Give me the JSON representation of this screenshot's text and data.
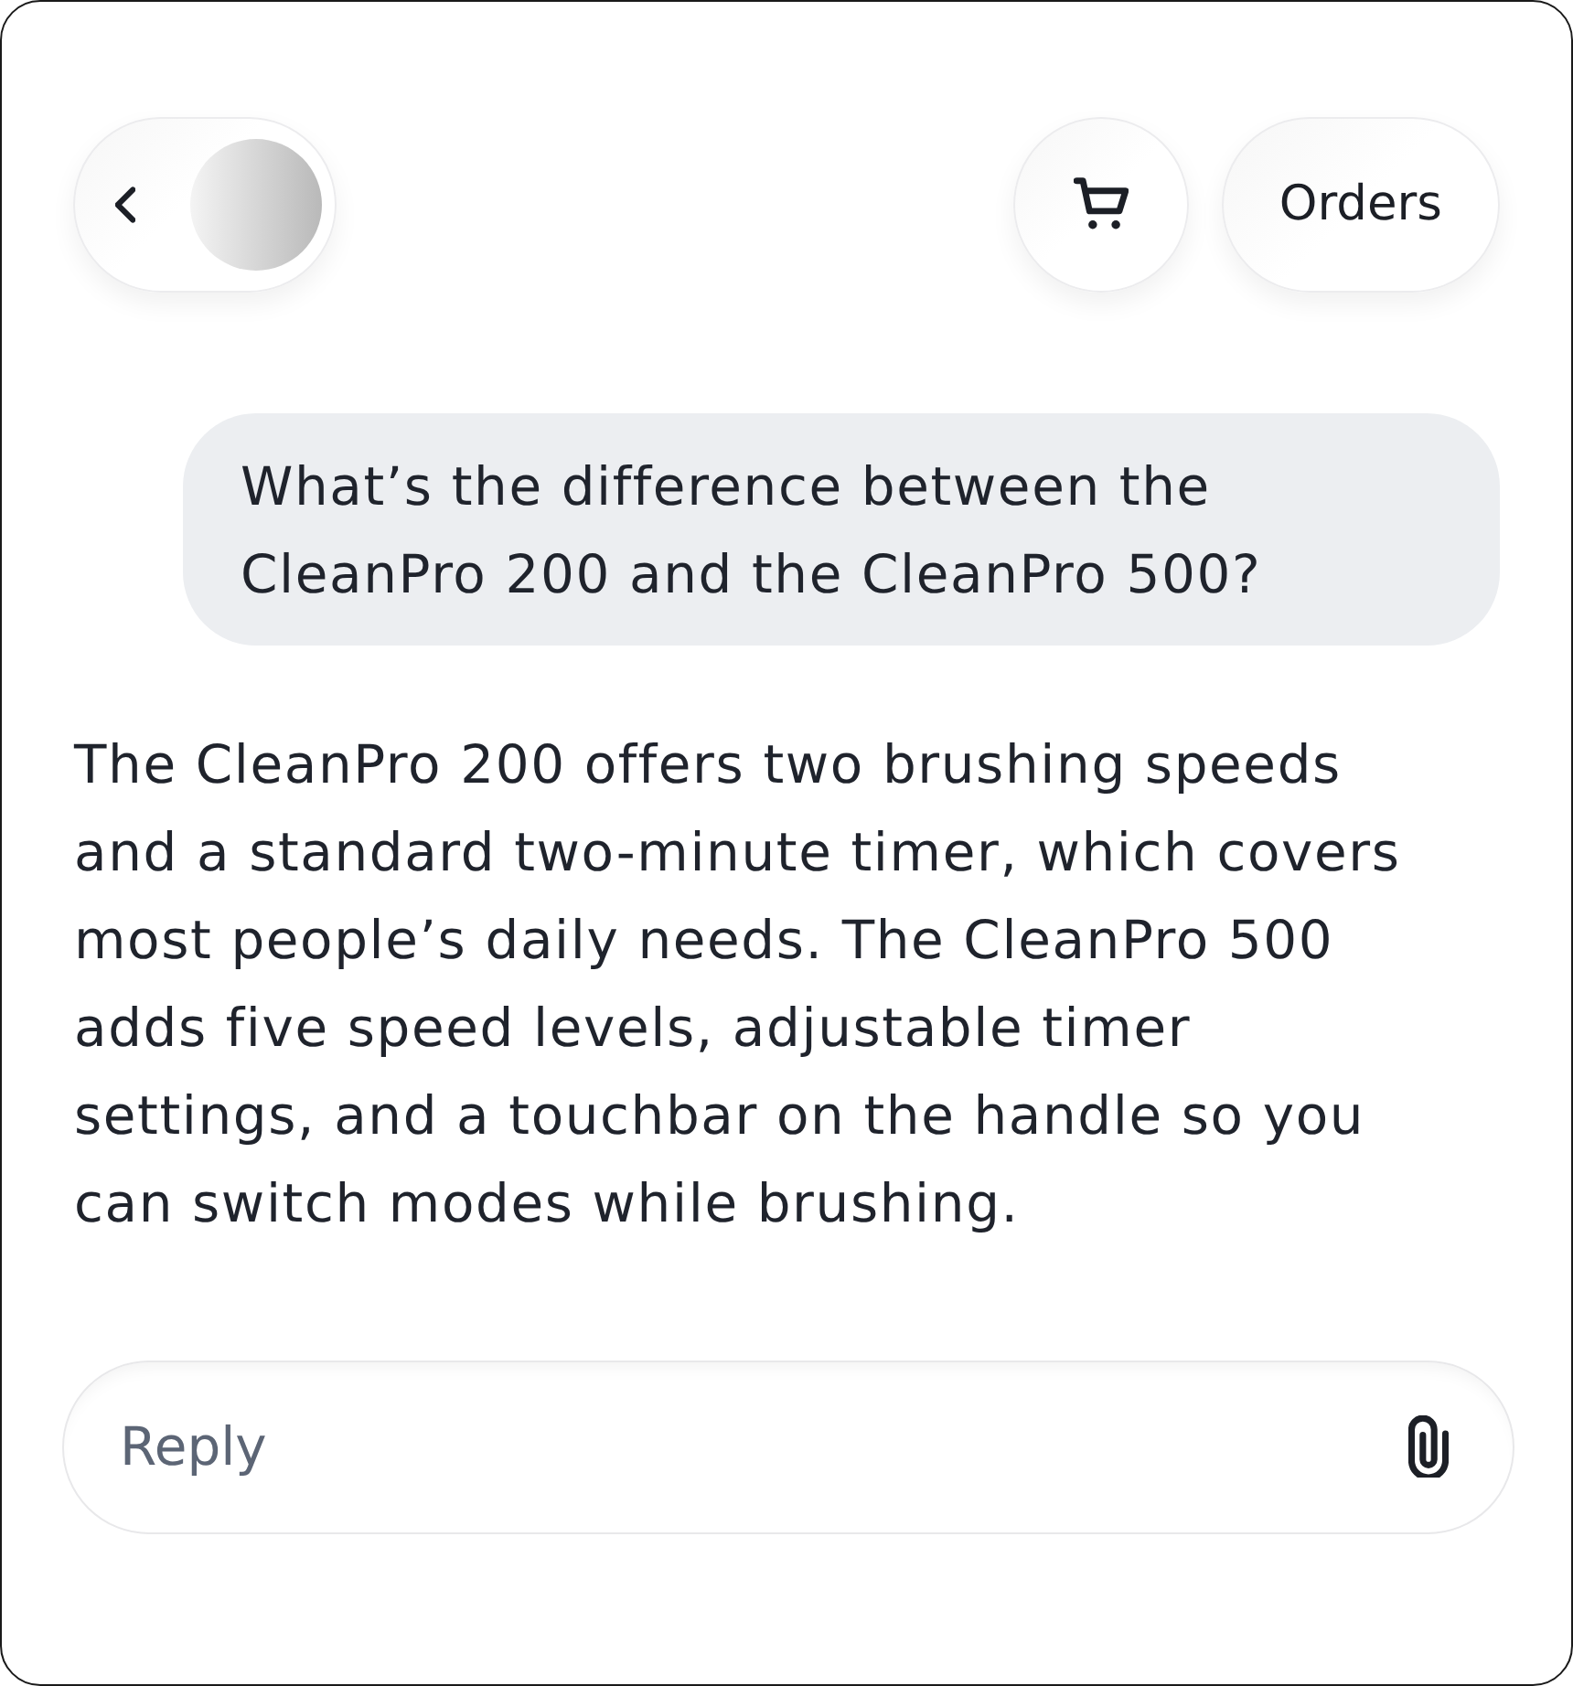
{
  "header": {
    "back": {
      "kind": "back_with_avatar"
    },
    "actions": [
      {
        "kind": "cart"
      },
      {
        "kind": "text",
        "label": "Orders"
      }
    ]
  },
  "messages": [
    {
      "kind": "bubble",
      "text": "What’s the difference between the CleanPro 200 and the CleanPro 500?"
    },
    {
      "kind": "plain",
      "text": "The CleanPro 200 offers two brushing speeds and a standard two-minute timer, which covers most people’s daily needs. The CleanPro 500 adds five speed levels, adjustable timer settings, and a touchbar on the handle so you can switch modes while brushing."
    }
  ],
  "composer": {
    "placeholder": "Reply"
  }
}
